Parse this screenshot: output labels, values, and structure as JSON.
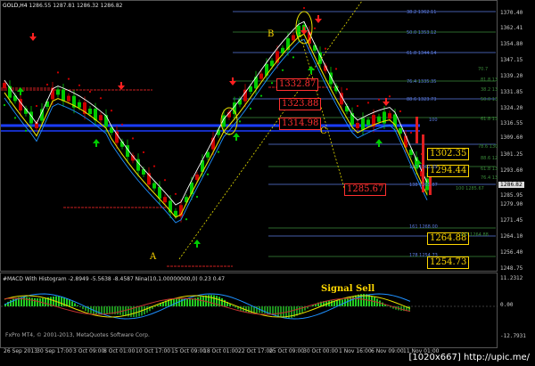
{
  "header": {
    "symbol_tf": "GOLD,H4",
    "ohlc": "1286.55 1287.81 1286.32 1286.82"
  },
  "macd_header": "#MACD With Histogram -2.8949 -5.5638 -8.4587  Nina(10,1.00000000,0) 0.23 0.47",
  "watermark": "FxPro MT4, © 2001-2013, MetaQuotes Software Corp.",
  "site_caption": "[1020x667] http://upic.me/",
  "price_axis": [
    "1370.40",
    "1362.41",
    "1354.80",
    "1347.15",
    "1339.20",
    "1331.85",
    "1324.20",
    "1316.55",
    "1309.60",
    "1301.25",
    "1293.60",
    "1285.95",
    "1279.90",
    "1271.45",
    "1264.10",
    "1256.40",
    "1248.75"
  ],
  "current_price": "1286.82",
  "macd_axis": [
    "11.2312",
    "0.00",
    "-12.7931"
  ],
  "time_axis": [
    "26 Sep 2013",
    "30 Sep 17:00",
    "3 Oct 09:00",
    "8 Oct 01:00",
    "10 Oct 17:00",
    "15 Oct 09:00",
    "18 Oct 01:00",
    "22 Oct 17:00",
    "25 Oct 09:00",
    "30 Oct 00:00",
    "1 Nov 16:00",
    "6 Nov 09:00",
    "11 Nov 01:00"
  ],
  "price_labels_red": [
    "1332.87",
    "1323.88",
    "1314.98",
    "1285.67"
  ],
  "price_labels_yellow": [
    "1302.35",
    "1294.44",
    "1264.88",
    "1254.73"
  ],
  "fib_levels": [
    "38.2 1362.11",
    "50.0 1353.12",
    "61.8 1344.14",
    "76.4 1335.35",
    "88.6 1323.73",
    "100",
    "127 1302.35",
    "138 1285.87",
    "161 1268.00",
    "178 1254.73",
    "78.6 1306.15",
    "70.7",
    "81.8 1331.50",
    "61.8 1314.52",
    "50.0 1321.62",
    "38.2 1325.32",
    "61.8 1306.71",
    "76.4 1301.37",
    "88.6 1294.50",
    "100 1285.67",
    "127 1264.88"
  ],
  "wave_labels": {
    "a": "A",
    "b": "B",
    "c": "C"
  },
  "signal_label": "Signal Sell",
  "colors": {
    "bull": "#00cc00",
    "bear": "#cc0000",
    "ma_yellow": "#e8e000",
    "ma_white": "#ffffff",
    "ma_blue": "#1e90ff",
    "fib_green": "#3a8a3a",
    "fib_blue": "#5a7ae0",
    "support_blue": "#1a3cff",
    "resistance_red": "#cc2020"
  },
  "icons": [
    "buy-arrow-icon",
    "sell-arrow-icon"
  ]
}
